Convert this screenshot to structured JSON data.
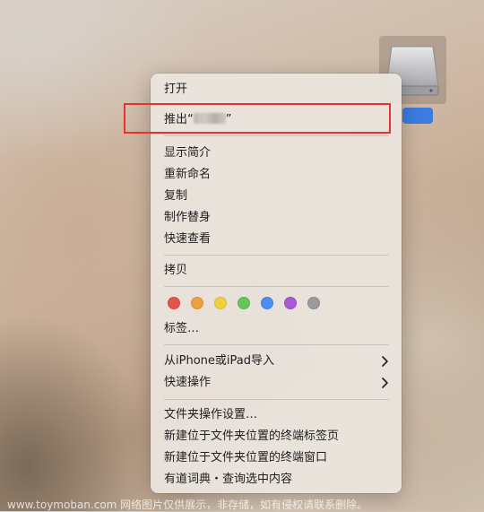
{
  "menu": {
    "open": "打开",
    "eject_prefix": "推出“",
    "eject_suffix": "”",
    "get_info": "显示简介",
    "rename": "重新命名",
    "duplicate": "复制",
    "make_alias": "制作替身",
    "quick_look": "快速查看",
    "copy": "拷贝",
    "tag_colors": [
      "#e5544b",
      "#eea040",
      "#f2cf3c",
      "#62c65a",
      "#4a8ef1",
      "#a75ad5",
      "#9a9a9c"
    ],
    "tags": "标签…",
    "import_from_iphone": "从iPhone或iPad导入",
    "quick_actions": "快速操作",
    "folder_action_settings": "文件夹操作设置…",
    "new_terminal_tab": "新建位于文件夹位置的终端标签页",
    "new_terminal_window": "新建位于文件夹位置的终端窗口",
    "youdao_lookup": "有道词典・查询选中内容"
  },
  "icons": {
    "submenu": "chevron-right-icon",
    "disk": "external-disk-icon"
  },
  "watermark": "www.toymoban.com 网络图片仅供展示，非存储，如有侵权请联系删除。"
}
